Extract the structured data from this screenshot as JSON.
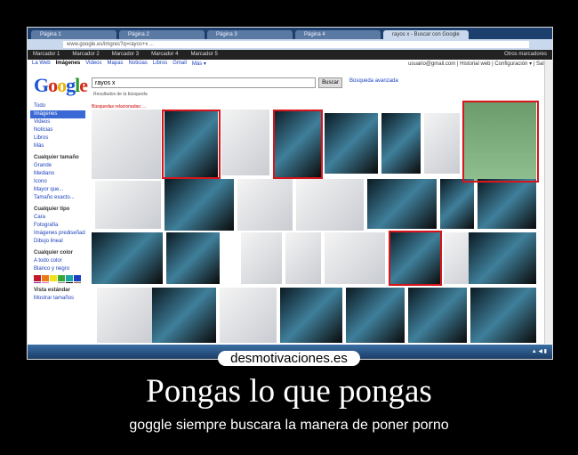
{
  "browser": {
    "tabs": [
      "Página 1",
      "Página 2",
      "Página 3",
      "Página 4",
      "rayos x - Buscar con Google"
    ],
    "url": "www.google.es/imgres?q=rayos+x ...",
    "bookmarks": [
      "Marcador 1",
      "Marcador 2",
      "Marcador 3",
      "Marcador 4",
      "Marcador 5"
    ],
    "other_bookmarks": "Otros marcadores"
  },
  "google": {
    "top_links": [
      "La Web",
      "Imágenes",
      "Videos",
      "Mapas",
      "Noticias",
      "Libros",
      "Gmail",
      "Más ▾"
    ],
    "user": "usuario@gmail.com | Historial web | Configuración ▾ | Salir",
    "logo": "Google",
    "query": "rayos x",
    "search_button": "Buscar",
    "advanced": "Búsqueda avanzada",
    "stats": "Resultados de la búsqueda",
    "related": "Búsquedas relacionadas: ...",
    "sidebar": {
      "nav": [
        "Todo",
        "Imágenes",
        "Videos",
        "Noticias",
        "Libros",
        "Más"
      ],
      "size_header": "Cualquier tamaño",
      "sizes": [
        "Grande",
        "Mediano",
        "Icono",
        "Mayor que...",
        "Tamaño exacto..."
      ],
      "type_header": "Cualquier tipo",
      "types": [
        "Cara",
        "Fotografía",
        "Imágenes prediseñadas",
        "Dibujo lineal"
      ],
      "color_header": "Cualquier color",
      "colors": [
        "A todo color",
        "Blanco y negro"
      ],
      "swatch_colors": [
        "#c0182c",
        "#e87a1c",
        "#f2e21a",
        "#3aa63a",
        "#1aa6a6",
        "#1c3ec0",
        "#7a2aa6",
        "#e86ab0",
        "#ffffff",
        "#888888",
        "#000000",
        "#8a5a2a"
      ],
      "view": [
        "Vista estándar",
        "Mostrar tamaños"
      ]
    }
  },
  "highlight_color": "#d6161c",
  "poster": {
    "brand": "desmotivaciones.es",
    "title": "Pongas lo que pongas",
    "subtitle": "goggle siempre buscara la manera de poner porno"
  }
}
